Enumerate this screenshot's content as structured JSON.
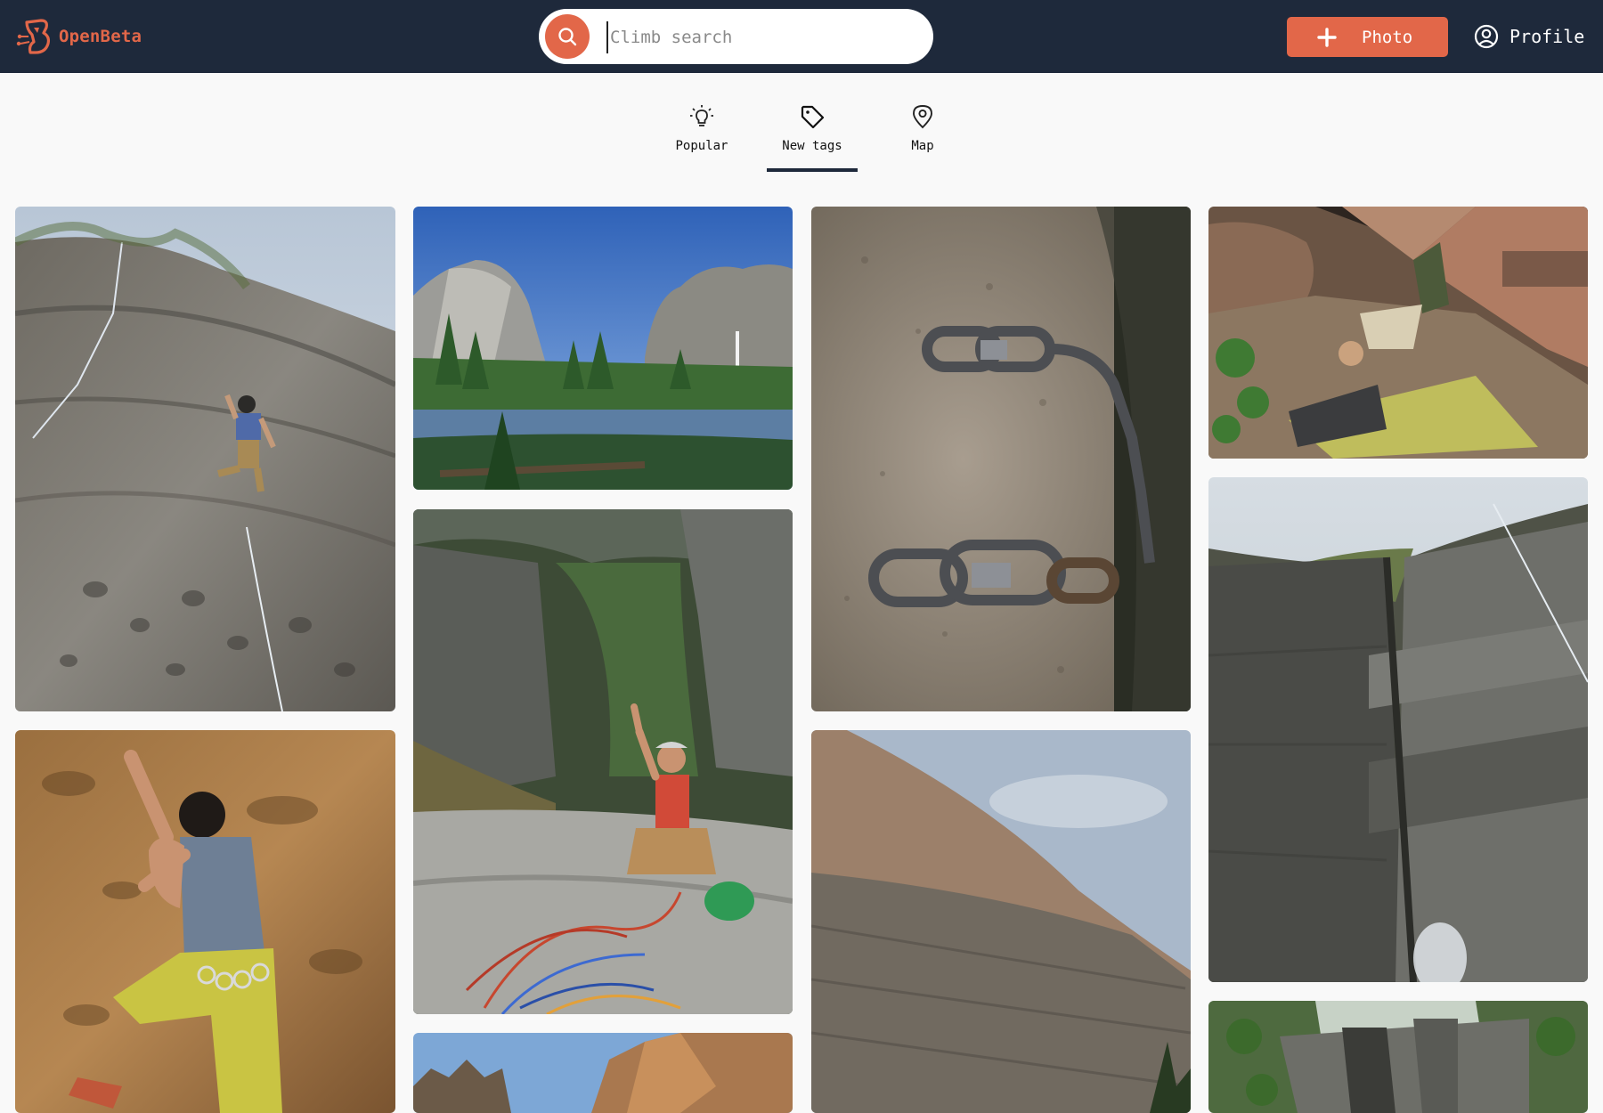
{
  "header": {
    "logo_text": "OpenBeta",
    "search": {
      "placeholder": "Climb search",
      "value": ""
    },
    "photo_button_label": "Photo",
    "profile_label": "Profile"
  },
  "tabs": [
    {
      "label": "Popular",
      "icon": "lightbulb-icon",
      "active": false
    },
    {
      "label": "New tags",
      "icon": "tag-icon",
      "active": true
    },
    {
      "label": "Map",
      "icon": "map-pin-icon",
      "active": false
    }
  ],
  "gallery": [
    {
      "name": "photo-climber-pocketed-wall",
      "column": 1
    },
    {
      "name": "photo-climber-yellow-pants",
      "column": 1
    },
    {
      "name": "photo-yosemite-valley-river",
      "column": 2
    },
    {
      "name": "photo-summit-climber-rope-pile",
      "column": 2
    },
    {
      "name": "photo-desert-towers",
      "column": 2
    },
    {
      "name": "photo-chain-anchor",
      "column": 3
    },
    {
      "name": "photo-granite-slab-sky",
      "column": 3
    },
    {
      "name": "photo-bouldering-cave-crashpad",
      "column": 4
    },
    {
      "name": "photo-dihedral-crack-looking-up",
      "column": 4
    },
    {
      "name": "photo-forest-crag",
      "column": 4
    }
  ],
  "colors": {
    "header_bg": "#1e293b",
    "accent": "#e26749",
    "page_bg": "#f9f9f9"
  }
}
